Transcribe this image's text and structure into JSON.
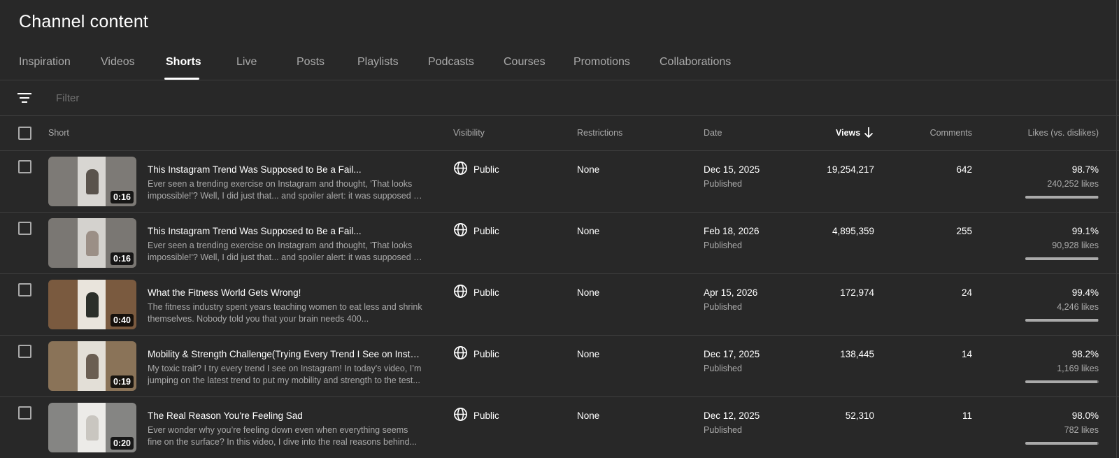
{
  "page": {
    "title": "Channel content"
  },
  "tabs": [
    {
      "label": "Inspiration",
      "active": false
    },
    {
      "label": "Videos",
      "active": false
    },
    {
      "label": "Shorts",
      "active": true
    },
    {
      "label": "Live",
      "active": false
    },
    {
      "label": "Posts",
      "active": false
    },
    {
      "label": "Playlists",
      "active": false
    },
    {
      "label": "Podcasts",
      "active": false
    },
    {
      "label": "Courses",
      "active": false
    },
    {
      "label": "Promotions",
      "active": false
    },
    {
      "label": "Collaborations",
      "active": false
    }
  ],
  "filter": {
    "placeholder": "Filter",
    "value": "",
    "icon": "filter-icon"
  },
  "table": {
    "columns": {
      "short": "Short",
      "visibility": "Visibility",
      "restrictions": "Restrictions",
      "date": "Date",
      "views": "Views",
      "comments": "Comments",
      "likes": "Likes (vs. dislikes)"
    },
    "sort": {
      "column": "views",
      "direction": "descending",
      "icon": "arrow-down-icon"
    },
    "rows": [
      {
        "duration": "0:16",
        "title": "This Instagram Trend Was Supposed to Be a Fail...",
        "description": "Ever seen a trending exercise on Instagram and thought, 'That looks impossible!'? Well, I did just that... and spoiler alert: it was supposed to be a fail...",
        "visibility": "Public",
        "restrictions": "None",
        "date": "Dec 15, 2025",
        "date_status": "Published",
        "views": "19,254,217",
        "comments": "642",
        "likes_pct": "98.7%",
        "likes_count": "240,252 likes",
        "likes_ratio": 0.987
      },
      {
        "duration": "0:16",
        "title": "This Instagram Trend Was Supposed to Be a Fail...",
        "description": "Ever seen a trending exercise on Instagram and thought, 'That looks impossible!'? Well, I did just that... and spoiler alert: it was supposed to be a fail...",
        "visibility": "Public",
        "restrictions": "None",
        "date": "Feb 18, 2026",
        "date_status": "Published",
        "views": "4,895,359",
        "comments": "255",
        "likes_pct": "99.1%",
        "likes_count": "90,928 likes",
        "likes_ratio": 0.991
      },
      {
        "duration": "0:40",
        "title": "What the Fitness World Gets Wrong!",
        "description": "The fitness industry spent years teaching women to eat less and shrink themselves. Nobody told you that your brain needs 400...",
        "visibility": "Public",
        "restrictions": "None",
        "date": "Apr 15, 2026",
        "date_status": "Published",
        "views": "172,974",
        "comments": "24",
        "likes_pct": "99.4%",
        "likes_count": "4,246 likes",
        "likes_ratio": 0.994
      },
      {
        "duration": "0:19",
        "title": "Mobility & Strength Challenge(Trying Every Trend I See on Instagram)",
        "description": "My toxic trait? I try every trend I see on Instagram! In today's video, I’m jumping on the latest trend to put my mobility and strength to the test...",
        "visibility": "Public",
        "restrictions": "None",
        "date": "Dec 17, 2025",
        "date_status": "Published",
        "views": "138,445",
        "comments": "14",
        "likes_pct": "98.2%",
        "likes_count": "1,169 likes",
        "likes_ratio": 0.982
      },
      {
        "duration": "0:20",
        "title": "The Real Reason You're Feeling Sad",
        "description": "Ever wonder why you’re feeling down even when everything seems fine on the surface? In this video, I dive into the real reasons behind...",
        "visibility": "Public",
        "restrictions": "None",
        "date": "Dec 12, 2025",
        "date_status": "Published",
        "views": "52,310",
        "comments": "11",
        "likes_pct": "98.0%",
        "likes_count": "782 likes",
        "likes_ratio": 0.98
      }
    ]
  },
  "colors": {
    "background": "#282828",
    "text_primary": "#ffffff",
    "text_secondary": "#aaaaaa",
    "divider": "#3e3e3e"
  }
}
